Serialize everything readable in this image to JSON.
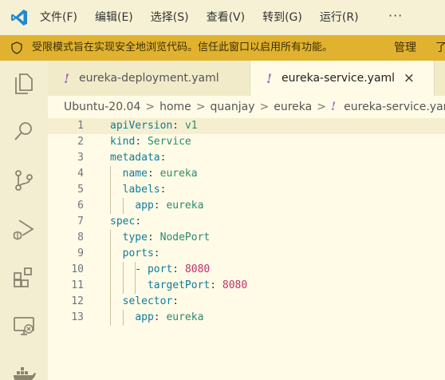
{
  "menu": {
    "items": [
      "文件(F)",
      "编辑(E)",
      "选择(S)",
      "查看(V)",
      "转到(G)",
      "运行(R)"
    ],
    "more": "···"
  },
  "banner": {
    "text": "受限模式旨在实现安全地浏览代码。信任此窗口以启用所有功能。",
    "manage": "管理",
    "more": "了"
  },
  "tabs": [
    {
      "label": "eureka-deployment.yaml",
      "icon": "!"
    },
    {
      "label": "eureka-service.yaml",
      "icon": "!",
      "close": "×"
    }
  ],
  "breadcrumb": {
    "items": [
      "Ubuntu-20.04",
      "home",
      "quanjay",
      "eureka",
      "eureka-service.yaml"
    ],
    "sep": ">",
    "icon": "!"
  },
  "editor": {
    "lines": [
      {
        "n": "1",
        "parts": [
          [
            "k",
            "apiVersion"
          ],
          [
            "p",
            ": "
          ],
          [
            "s",
            "v1"
          ]
        ]
      },
      {
        "n": "2",
        "parts": [
          [
            "k",
            "kind"
          ],
          [
            "p",
            ": "
          ],
          [
            "s",
            "Service"
          ]
        ]
      },
      {
        "n": "3",
        "parts": [
          [
            "k",
            "metadata"
          ],
          [
            "p",
            ":"
          ]
        ]
      },
      {
        "n": "4",
        "parts": [
          [
            "p",
            "  "
          ],
          [
            "k",
            "name"
          ],
          [
            "p",
            ": "
          ],
          [
            "s",
            "eureka"
          ]
        ]
      },
      {
        "n": "5",
        "parts": [
          [
            "p",
            "  "
          ],
          [
            "k",
            "labels"
          ],
          [
            "p",
            ":"
          ]
        ]
      },
      {
        "n": "6",
        "parts": [
          [
            "p",
            "    "
          ],
          [
            "k",
            "app"
          ],
          [
            "p",
            ": "
          ],
          [
            "s",
            "eureka"
          ]
        ]
      },
      {
        "n": "7",
        "parts": [
          [
            "k",
            "spec"
          ],
          [
            "p",
            ":"
          ]
        ]
      },
      {
        "n": "8",
        "parts": [
          [
            "p",
            "  "
          ],
          [
            "k",
            "type"
          ],
          [
            "p",
            ": "
          ],
          [
            "s",
            "NodePort"
          ]
        ]
      },
      {
        "n": "9",
        "parts": [
          [
            "p",
            "  "
          ],
          [
            "k",
            "ports"
          ],
          [
            "p",
            ":"
          ]
        ]
      },
      {
        "n": "10",
        "parts": [
          [
            "p",
            "    - "
          ],
          [
            "k",
            "port"
          ],
          [
            "p",
            ": "
          ],
          [
            "n",
            "8080"
          ]
        ]
      },
      {
        "n": "11",
        "parts": [
          [
            "p",
            "      "
          ],
          [
            "k",
            "targetPort"
          ],
          [
            "p",
            ": "
          ],
          [
            "n",
            "8080"
          ]
        ]
      },
      {
        "n": "12",
        "parts": [
          [
            "p",
            "  "
          ],
          [
            "k",
            "selector"
          ],
          [
            "p",
            ":"
          ]
        ]
      },
      {
        "n": "13",
        "parts": [
          [
            "p",
            "    "
          ],
          [
            "k",
            "app"
          ],
          [
            "p",
            ": "
          ],
          [
            "s",
            "eureka"
          ]
        ]
      }
    ]
  },
  "colors": {
    "key": "#0f7b9c",
    "string": "#2b8a6e",
    "number": "#c0306a",
    "banner": "#e0b230",
    "vscode_blue": "#1f8ad2"
  }
}
